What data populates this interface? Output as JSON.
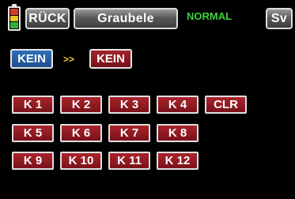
{
  "header": {
    "back_label": "RÜCK",
    "model_name": "Graubele",
    "flight_mode": "NORMAL",
    "sv_label": "Sv",
    "battery_colors": [
      "#d63a2a",
      "#e6c41d",
      "#33b03a"
    ]
  },
  "selector": {
    "source_label": "KEIN",
    "arrow_symbol": ">>",
    "target_label": "KEIN"
  },
  "channels": {
    "buttons": [
      "K 1",
      "K 2",
      "K 3",
      "K 4",
      "CLR",
      "K 5",
      "K 6",
      "K 7",
      "K 8",
      "K 9",
      "K 10",
      "K 11",
      "K 12"
    ]
  },
  "colors": {
    "background": "#000000",
    "mode_green": "#3cd23c",
    "channel_red": "#8c1a20",
    "selector_blue": "#2560a4",
    "arrow_yellow": "#e8d23a"
  }
}
